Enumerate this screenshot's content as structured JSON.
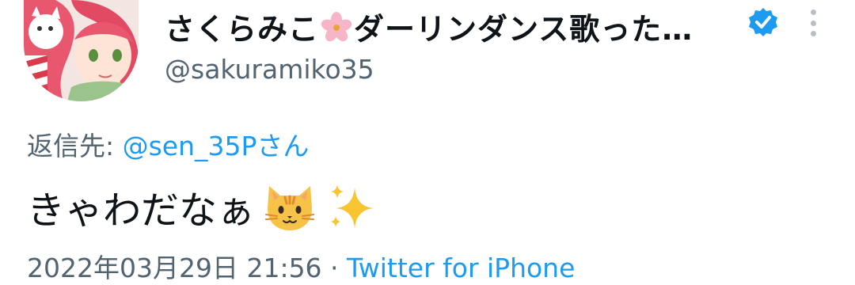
{
  "tweet": {
    "display_name": "さくらみこ",
    "display_name_rest": "ダーリンダンス歌った…",
    "handle": "@sakuramiko35",
    "reply_prefix": "返信先: ",
    "reply_mention": "@sen_35Pさん",
    "text": "きゃわだなぁ",
    "timestamp": "2022年03月29日 21:56",
    "separator": " · ",
    "source": "Twitter for iPhone",
    "icons": [
      "avatar",
      "cherry-blossom-icon",
      "verified-badge-icon",
      "more-options-icon",
      "cat-face-icon",
      "sparkles-icon"
    ]
  },
  "colors": {
    "link": "#1d9bf0",
    "secondary_text": "#536471",
    "verified": "#1d9bf0"
  }
}
